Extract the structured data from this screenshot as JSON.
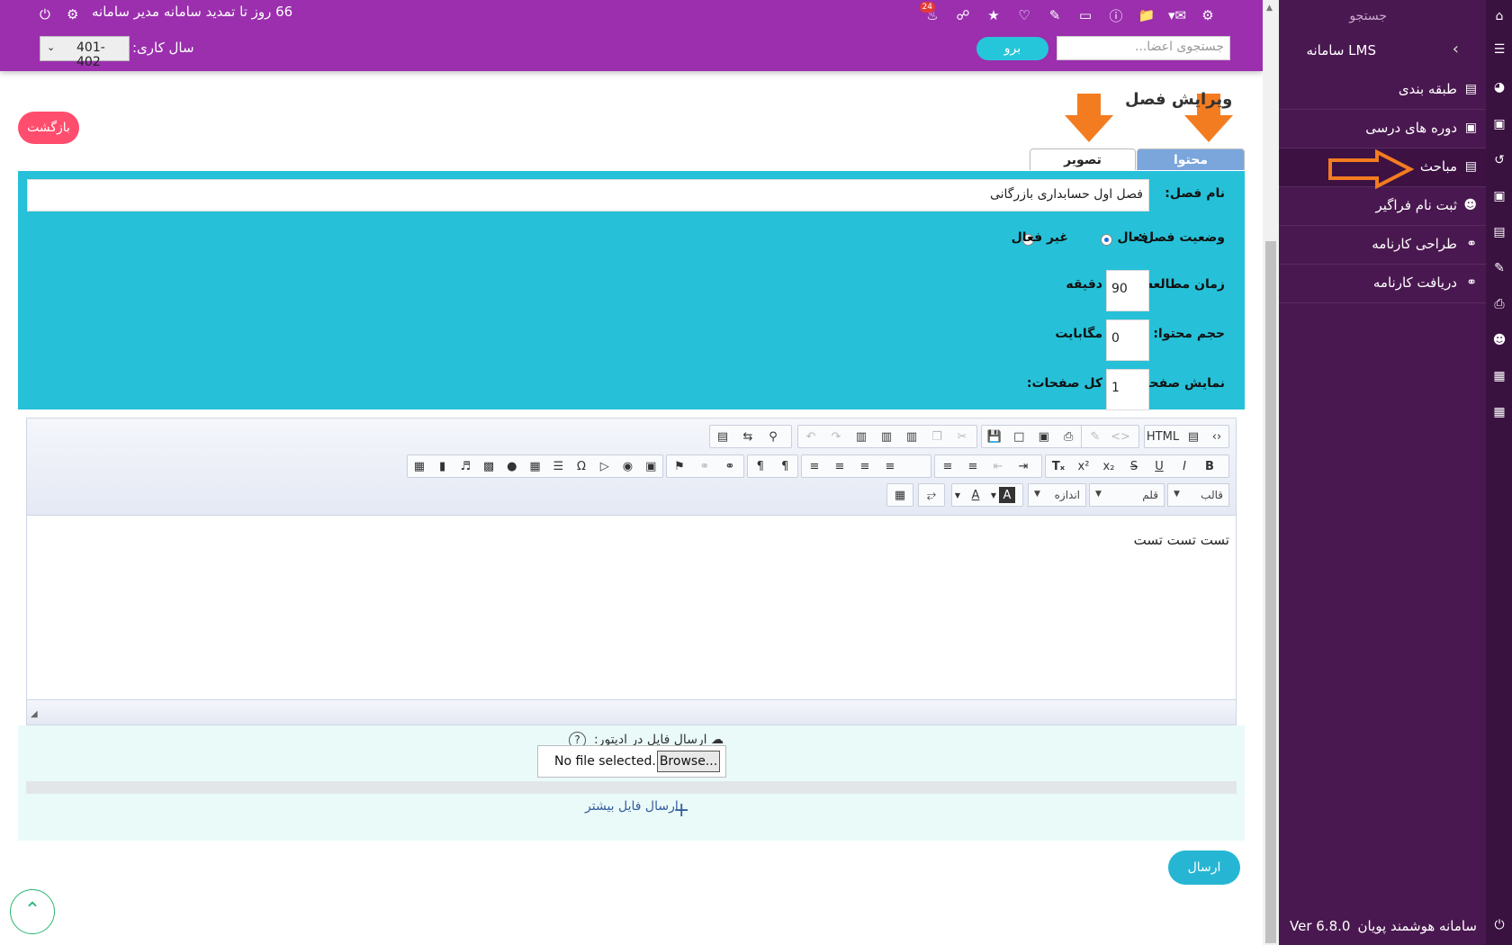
{
  "header": {
    "renew_text": "66 روز تا تمدید سامانه مدیر سامانه",
    "notification_count": "24",
    "search_placeholder": "جستجوی اعضا...",
    "go_label": "برو",
    "year_label": "سال کاری:",
    "year_value": "401-402"
  },
  "sidebar": {
    "search_label": "جستجو",
    "title": "سامانه LMS",
    "items": [
      {
        "label": "طبقه بندی"
      },
      {
        "label": "دوره های درسی"
      },
      {
        "label": "مباحث"
      },
      {
        "label": "ثبت نام فراگیر"
      },
      {
        "label": "طراحی کارنامه"
      },
      {
        "label": "دریافت کارنامه"
      }
    ],
    "footer_app": "سامانه هوشمند پویان",
    "footer_version": "Ver 6.8.0"
  },
  "page": {
    "title": "ویرایش فصل",
    "back_label": "بازگشت",
    "tabs": [
      {
        "label": "محتوا",
        "active": true
      },
      {
        "label": "تصویر",
        "active": false
      }
    ]
  },
  "form": {
    "name_label": "نام فصل:",
    "name_value": "فصل اول حسابداری بازرگانی",
    "status_label": "وضعیت فصل:",
    "status_active": "فعال",
    "status_inactive": "غیر فعال",
    "study_time_label": "زمان مطالعه:",
    "study_time_value": "90",
    "study_time_unit": "دقیقه",
    "size_label": "حجم محتوا:",
    "size_value": "0",
    "size_unit": "مگابایت",
    "pages_label": "نمایش صفحه:",
    "pages_value": "1",
    "pages_total_label": "کل صفحات:"
  },
  "editor": {
    "html_label": "HTML",
    "format_select": "قالب",
    "font_select": "قلم",
    "size_select": "اندازه",
    "body_text": "تست تست تست"
  },
  "upload": {
    "label": "ارسال فایل در ادیتور:",
    "help": "?",
    "browse_label": "Browse...",
    "no_file": "No file selected.",
    "more_files": "ارسال فایل بیشتر"
  },
  "actions": {
    "send_label": "ارسال"
  },
  "colors": {
    "header": "#9b2fae",
    "sidebar": "#4a1850",
    "panel": "#26c1d8",
    "accent_button": "#26c6da",
    "back_button": "#ff4d6d"
  }
}
